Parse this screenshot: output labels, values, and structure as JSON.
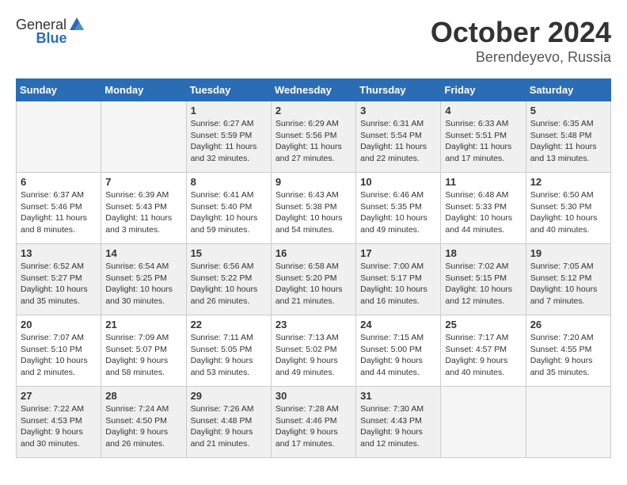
{
  "header": {
    "logo_general": "General",
    "logo_blue": "Blue",
    "month": "October 2024",
    "location": "Berendeyevo, Russia"
  },
  "weekdays": [
    "Sunday",
    "Monday",
    "Tuesday",
    "Wednesday",
    "Thursday",
    "Friday",
    "Saturday"
  ],
  "weeks": [
    [
      {
        "day": "",
        "info": ""
      },
      {
        "day": "",
        "info": ""
      },
      {
        "day": "1",
        "info": "Sunrise: 6:27 AM\nSunset: 5:59 PM\nDaylight: 11 hours and 32 minutes."
      },
      {
        "day": "2",
        "info": "Sunrise: 6:29 AM\nSunset: 5:56 PM\nDaylight: 11 hours and 27 minutes."
      },
      {
        "day": "3",
        "info": "Sunrise: 6:31 AM\nSunset: 5:54 PM\nDaylight: 11 hours and 22 minutes."
      },
      {
        "day": "4",
        "info": "Sunrise: 6:33 AM\nSunset: 5:51 PM\nDaylight: 11 hours and 17 minutes."
      },
      {
        "day": "5",
        "info": "Sunrise: 6:35 AM\nSunset: 5:48 PM\nDaylight: 11 hours and 13 minutes."
      }
    ],
    [
      {
        "day": "6",
        "info": "Sunrise: 6:37 AM\nSunset: 5:46 PM\nDaylight: 11 hours and 8 minutes."
      },
      {
        "day": "7",
        "info": "Sunrise: 6:39 AM\nSunset: 5:43 PM\nDaylight: 11 hours and 3 minutes."
      },
      {
        "day": "8",
        "info": "Sunrise: 6:41 AM\nSunset: 5:40 PM\nDaylight: 10 hours and 59 minutes."
      },
      {
        "day": "9",
        "info": "Sunrise: 6:43 AM\nSunset: 5:38 PM\nDaylight: 10 hours and 54 minutes."
      },
      {
        "day": "10",
        "info": "Sunrise: 6:46 AM\nSunset: 5:35 PM\nDaylight: 10 hours and 49 minutes."
      },
      {
        "day": "11",
        "info": "Sunrise: 6:48 AM\nSunset: 5:33 PM\nDaylight: 10 hours and 44 minutes."
      },
      {
        "day": "12",
        "info": "Sunrise: 6:50 AM\nSunset: 5:30 PM\nDaylight: 10 hours and 40 minutes."
      }
    ],
    [
      {
        "day": "13",
        "info": "Sunrise: 6:52 AM\nSunset: 5:27 PM\nDaylight: 10 hours and 35 minutes."
      },
      {
        "day": "14",
        "info": "Sunrise: 6:54 AM\nSunset: 5:25 PM\nDaylight: 10 hours and 30 minutes."
      },
      {
        "day": "15",
        "info": "Sunrise: 6:56 AM\nSunset: 5:22 PM\nDaylight: 10 hours and 26 minutes."
      },
      {
        "day": "16",
        "info": "Sunrise: 6:58 AM\nSunset: 5:20 PM\nDaylight: 10 hours and 21 minutes."
      },
      {
        "day": "17",
        "info": "Sunrise: 7:00 AM\nSunset: 5:17 PM\nDaylight: 10 hours and 16 minutes."
      },
      {
        "day": "18",
        "info": "Sunrise: 7:02 AM\nSunset: 5:15 PM\nDaylight: 10 hours and 12 minutes."
      },
      {
        "day": "19",
        "info": "Sunrise: 7:05 AM\nSunset: 5:12 PM\nDaylight: 10 hours and 7 minutes."
      }
    ],
    [
      {
        "day": "20",
        "info": "Sunrise: 7:07 AM\nSunset: 5:10 PM\nDaylight: 10 hours and 2 minutes."
      },
      {
        "day": "21",
        "info": "Sunrise: 7:09 AM\nSunset: 5:07 PM\nDaylight: 9 hours and 58 minutes."
      },
      {
        "day": "22",
        "info": "Sunrise: 7:11 AM\nSunset: 5:05 PM\nDaylight: 9 hours and 53 minutes."
      },
      {
        "day": "23",
        "info": "Sunrise: 7:13 AM\nSunset: 5:02 PM\nDaylight: 9 hours and 49 minutes."
      },
      {
        "day": "24",
        "info": "Sunrise: 7:15 AM\nSunset: 5:00 PM\nDaylight: 9 hours and 44 minutes."
      },
      {
        "day": "25",
        "info": "Sunrise: 7:17 AM\nSunset: 4:57 PM\nDaylight: 9 hours and 40 minutes."
      },
      {
        "day": "26",
        "info": "Sunrise: 7:20 AM\nSunset: 4:55 PM\nDaylight: 9 hours and 35 minutes."
      }
    ],
    [
      {
        "day": "27",
        "info": "Sunrise: 7:22 AM\nSunset: 4:53 PM\nDaylight: 9 hours and 30 minutes."
      },
      {
        "day": "28",
        "info": "Sunrise: 7:24 AM\nSunset: 4:50 PM\nDaylight: 9 hours and 26 minutes."
      },
      {
        "day": "29",
        "info": "Sunrise: 7:26 AM\nSunset: 4:48 PM\nDaylight: 9 hours and 21 minutes."
      },
      {
        "day": "30",
        "info": "Sunrise: 7:28 AM\nSunset: 4:46 PM\nDaylight: 9 hours and 17 minutes."
      },
      {
        "day": "31",
        "info": "Sunrise: 7:30 AM\nSunset: 4:43 PM\nDaylight: 9 hours and 12 minutes."
      },
      {
        "day": "",
        "info": ""
      },
      {
        "day": "",
        "info": ""
      }
    ]
  ]
}
